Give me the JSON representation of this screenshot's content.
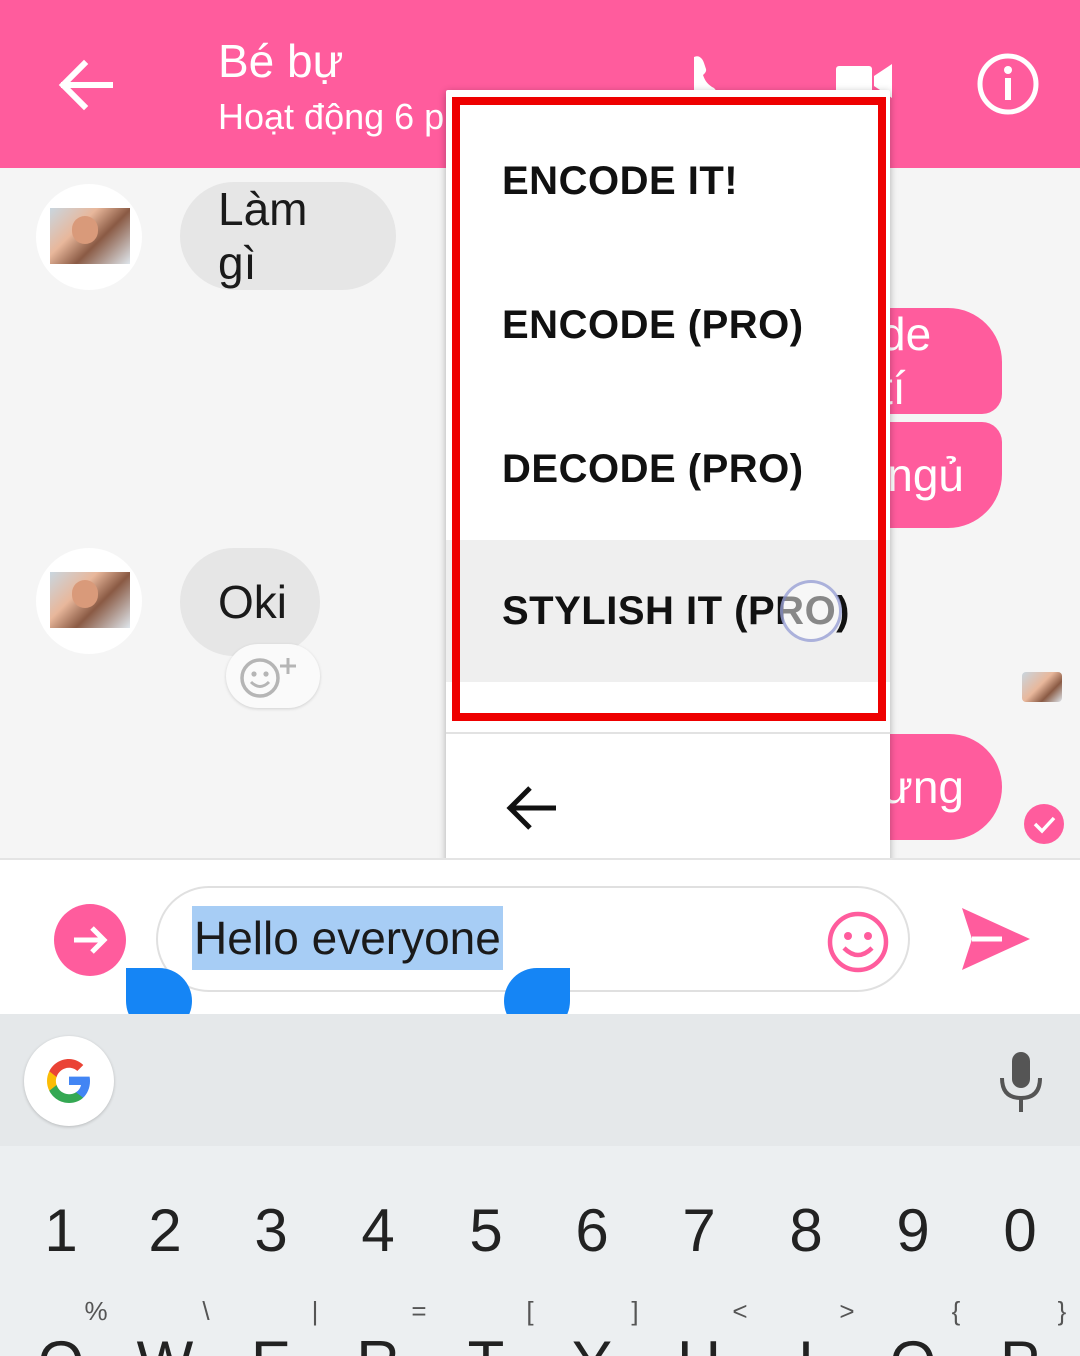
{
  "header": {
    "contact_name": "Bé bự",
    "status": "Hoạt động 6 p"
  },
  "messages": {
    "incoming": [
      "Làm gì",
      "Oki"
    ],
    "outgoing_partial": [
      "de tí",
      "ngủ",
      "ưng"
    ]
  },
  "menu": {
    "items": [
      "ENCODE IT!",
      "ENCODE (PRO)",
      "DECODE (PRO)",
      "STYLISH IT (PRO)"
    ],
    "pressed_index": 3
  },
  "composer": {
    "input_value": "Hello everyone"
  },
  "keyboard": {
    "numbers": [
      "1",
      "2",
      "3",
      "4",
      "5",
      "6",
      "7",
      "8",
      "9",
      "0"
    ],
    "symbols": [
      "%",
      "\\",
      "|",
      "=",
      "[",
      "]",
      "<",
      ">",
      "{",
      "}"
    ],
    "letters": [
      "Q",
      "W",
      "E",
      "R",
      "T",
      "Y",
      "U",
      "I",
      "O",
      "P"
    ]
  },
  "colors": {
    "accent": "#ff5c9d",
    "highlight_box": "#ee0000",
    "selection": "#a7cdf5",
    "handle": "#1585f5"
  },
  "icons": [
    "back-arrow-icon",
    "phone-icon",
    "video-camera-icon",
    "info-icon",
    "add-reaction-icon",
    "seen-check-icon",
    "expand-arrow-icon",
    "emoji-icon",
    "send-icon",
    "google-g-icon",
    "microphone-icon"
  ]
}
